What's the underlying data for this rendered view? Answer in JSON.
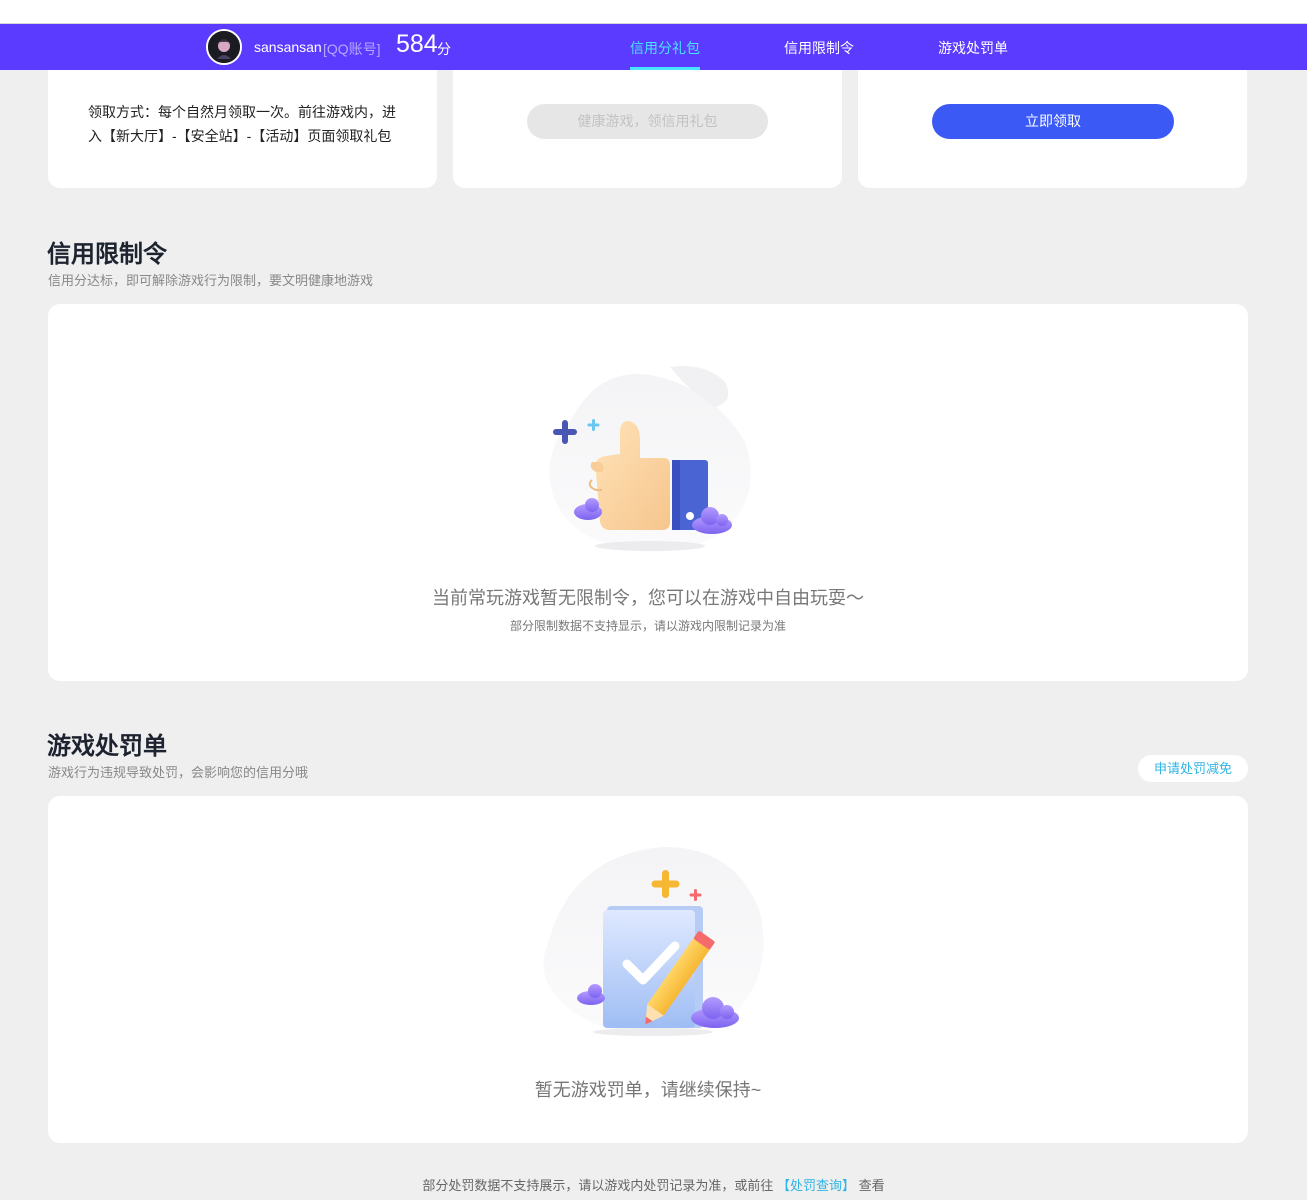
{
  "header": {
    "username": "sansansan",
    "account_type": "[QQ账号]",
    "score": "584",
    "score_unit": "分",
    "tabs": [
      {
        "label": "信用分礼包",
        "active": true
      },
      {
        "label": "信用限制令",
        "active": false
      },
      {
        "label": "游戏处罚单",
        "active": false
      }
    ],
    "accent_color": "#5a3bff",
    "active_tab_color": "#49e4ff"
  },
  "gift": {
    "method_text": "领取方式：每个自然月领取一次。前往游戏内，进入【新大厅】-【安全站】-【活动】页面领取礼包",
    "disabled_button": "健康游戏，领信用礼包",
    "claim_button": "立即领取",
    "claim_color": "#3a59f5"
  },
  "restriction": {
    "title": "信用限制令",
    "subtitle": "信用分达标，即可解除游戏行为限制，要文明健康地游戏",
    "empty_main": "当前常玩游戏暂无限制令，您可以在游戏中自由玩耍～",
    "empty_sub": "部分限制数据不支持显示，请以游戏内限制记录为准",
    "illustration": "thumbs-up-icon"
  },
  "penalty": {
    "title": "游戏处罚单",
    "subtitle": "游戏行为违规导致处罚，会影响您的信用分哦",
    "apply_button": "申请处罚减免",
    "empty_main": "暂无游戏罚单，请继续保持~",
    "illustration": "checklist-pencil-icon"
  },
  "footer": {
    "text_before": "部分处罚数据不支持展示，请以游戏内处罚记录为准，或前往",
    "link": "【处罚查询】",
    "text_after": "查看",
    "link_color": "#2fb4e6"
  }
}
